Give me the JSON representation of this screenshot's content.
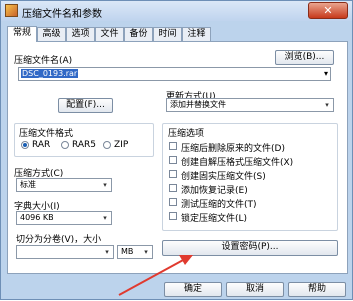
{
  "window": {
    "title": "压缩文件名和参数",
    "close_glyph": "✕"
  },
  "tabs": [
    {
      "label": "常规",
      "active": true
    },
    {
      "label": "高级"
    },
    {
      "label": "选项"
    },
    {
      "label": "文件"
    },
    {
      "label": "备份"
    },
    {
      "label": "时间"
    },
    {
      "label": "注释"
    }
  ],
  "archive_name": {
    "label": "压缩文件名(A)",
    "value": "DSC_0193.rar",
    "browse_label": "浏览(B)..."
  },
  "profile_button": "配置(F)...",
  "update_mode": {
    "label": "更新方式(U)",
    "value": "添加并替换文件"
  },
  "format": {
    "label": "压缩文件格式",
    "options": [
      "RAR",
      "RAR5",
      "ZIP"
    ],
    "selected": "RAR"
  },
  "method": {
    "label": "压缩方式(C)",
    "value": "标准"
  },
  "dictionary": {
    "label": "字典大小(I)",
    "value": "4096 KB"
  },
  "split": {
    "label": "切分为分卷(V)，大小",
    "unit": "MB"
  },
  "options": {
    "label": "压缩选项",
    "items": [
      {
        "label": "压缩后删除原来的文件(D)",
        "checked": false
      },
      {
        "label": "创建自解压格式压缩文件(X)",
        "checked": false
      },
      {
        "label": "创建固实压缩文件(S)",
        "checked": false
      },
      {
        "label": "添加恢复记录(E)",
        "checked": false
      },
      {
        "label": "测试压缩的文件(T)",
        "checked": false
      },
      {
        "label": "锁定压缩文件(L)",
        "checked": false
      }
    ]
  },
  "password_button": "设置密码(P)...",
  "footer": {
    "ok": "确定",
    "cancel": "取消",
    "help": "帮助"
  },
  "colors": {
    "accent": "#3169c6",
    "annotation_arrow": "#e03a2f"
  }
}
